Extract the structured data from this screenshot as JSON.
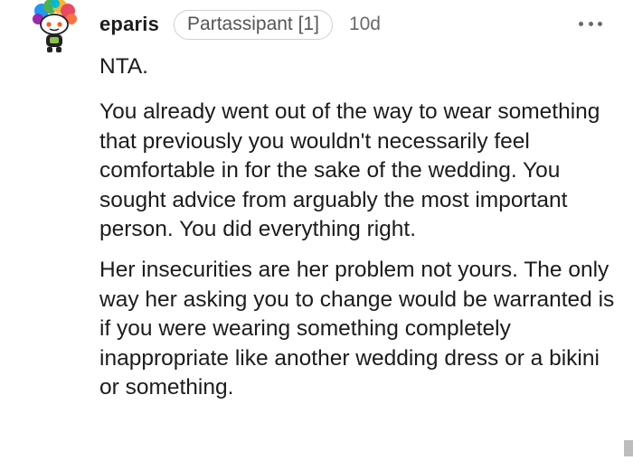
{
  "comment": {
    "username": "eparis",
    "flair": "Partassipant [1]",
    "timestamp": "10d",
    "verdict": "NTA.",
    "paragraphs": [
      "You already went out of the way to wear something that previously you wouldn't necessarily feel comfortable in for the sake of the wedding. You sought advice from arguably the most important person. You did everything right.",
      "Her insecurities are her problem not yours. The only way her asking you to change would be warranted is if you were wearing something completely inappropriate like another wedding dress or a bikini or something."
    ]
  },
  "icons": {
    "avatar": "snoo-avatar-rainbow-hair",
    "more": "more-options-icon"
  },
  "colors": {
    "text": "#1c1c1c",
    "muted": "#6a6a6a",
    "flair_border": "#d0d0d0",
    "avatar_hair": [
      "#e84a5f",
      "#f7b733",
      "#4caf50",
      "#2196f3",
      "#9c27b0"
    ]
  }
}
